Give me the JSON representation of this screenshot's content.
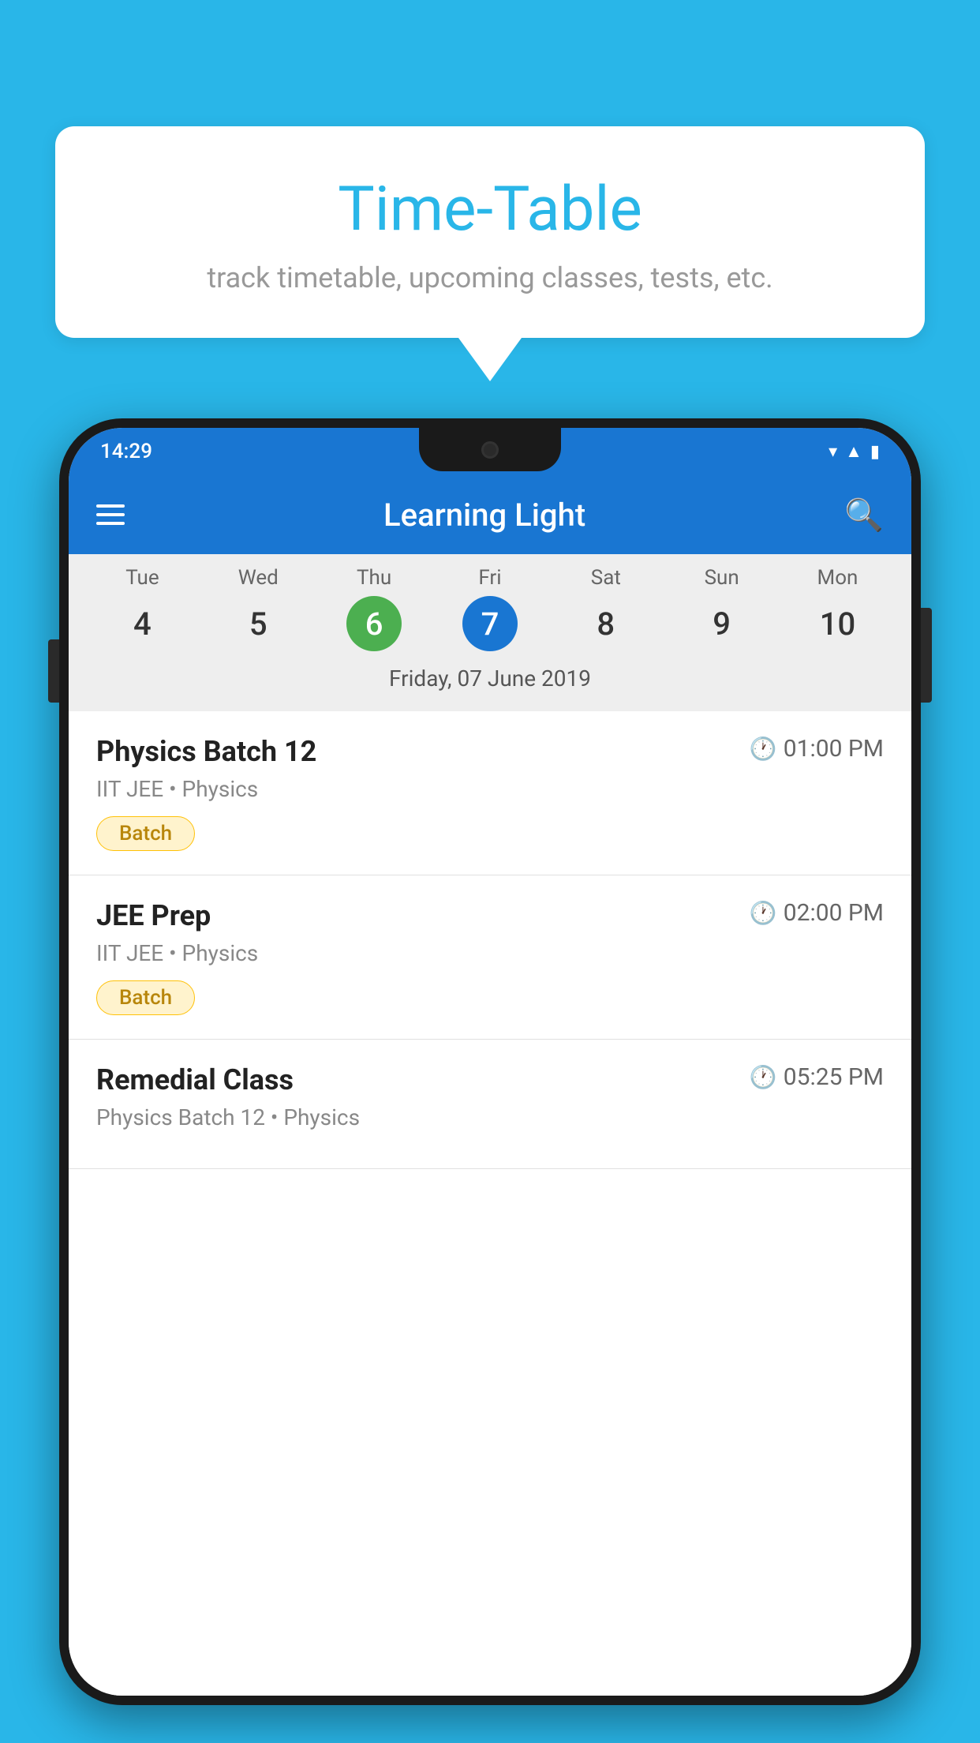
{
  "background_color": "#29b6e8",
  "speech_bubble": {
    "title": "Time-Table",
    "subtitle": "track timetable, upcoming classes, tests, etc."
  },
  "phone": {
    "status_bar": {
      "time": "14:29"
    },
    "app_bar": {
      "title": "Learning Light"
    },
    "calendar": {
      "days": [
        {
          "name": "Tue",
          "number": "4",
          "state": "normal"
        },
        {
          "name": "Wed",
          "number": "5",
          "state": "normal"
        },
        {
          "name": "Thu",
          "number": "6",
          "state": "today"
        },
        {
          "name": "Fri",
          "number": "7",
          "state": "selected"
        },
        {
          "name": "Sat",
          "number": "8",
          "state": "normal"
        },
        {
          "name": "Sun",
          "number": "9",
          "state": "normal"
        },
        {
          "name": "Mon",
          "number": "10",
          "state": "normal"
        }
      ],
      "selected_date_label": "Friday, 07 June 2019"
    },
    "schedule": [
      {
        "title": "Physics Batch 12",
        "time": "01:00 PM",
        "subtitle": "IIT JEE • Physics",
        "badge": "Batch"
      },
      {
        "title": "JEE Prep",
        "time": "02:00 PM",
        "subtitle": "IIT JEE • Physics",
        "badge": "Batch"
      },
      {
        "title": "Remedial Class",
        "time": "05:25 PM",
        "subtitle": "Physics Batch 12 • Physics",
        "badge": null
      }
    ]
  }
}
